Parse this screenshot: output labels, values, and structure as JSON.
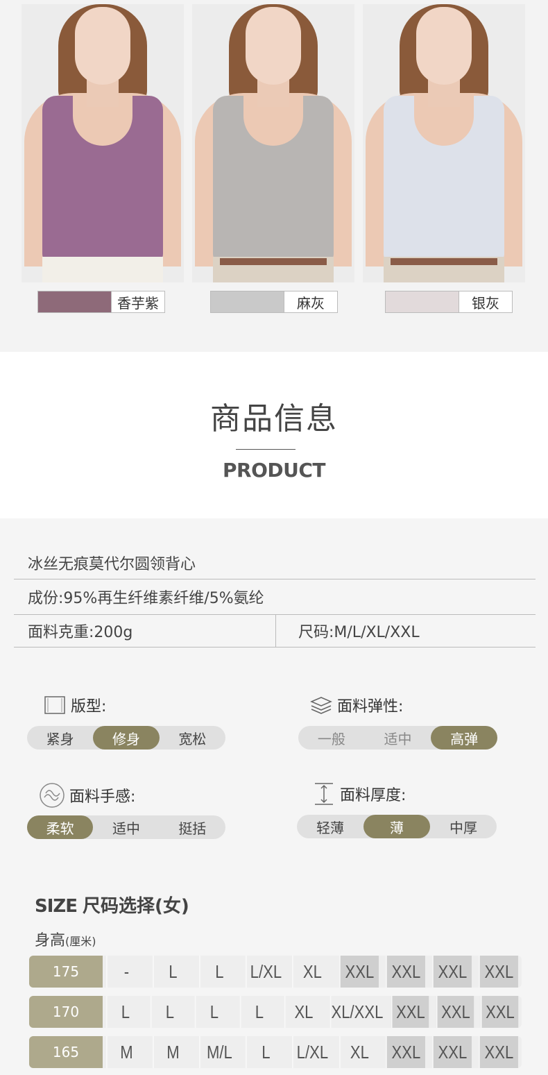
{
  "colors": [
    {
      "name": "香芋紫",
      "hex": "#8e6a79",
      "top_hex": "#9a6b92"
    },
    {
      "name": "麻灰",
      "hex": "#c9c9c9",
      "top_hex": "#b8b5b3"
    },
    {
      "name": "银灰",
      "hex": "#e2dadb",
      "top_hex": "#dde1ea"
    }
  ],
  "section": {
    "title": "商品信息",
    "subtitle": "PRODUCT"
  },
  "info": {
    "product_name": "冰丝无痕莫代尔圆领背心",
    "composition": "成份:95%再生纤维素纤维/5%氨纶",
    "weight": "面料克重:200g",
    "sizes": "尺码:M/L/XL/XXL"
  },
  "attributes": {
    "fit": {
      "label": "版型:",
      "options": [
        "紧身",
        "修身",
        "宽松"
      ],
      "selected": 1,
      "icon": "shirt-icon"
    },
    "elasticity": {
      "label": "面料弹性:",
      "options": [
        "一般",
        "适中",
        "高弹"
      ],
      "selected": 2,
      "icon": "layers-icon"
    },
    "feel": {
      "label": "面料手感:",
      "options": [
        "柔软",
        "适中",
        "挺括"
      ],
      "selected": 0,
      "icon": "texture-icon"
    },
    "thickness": {
      "label": "面料厚度:",
      "options": [
        "轻薄",
        "薄",
        "中厚"
      ],
      "selected": 1,
      "icon": "thickness-icon"
    }
  },
  "size_chart": {
    "title_en": "SIZE",
    "title_cn": "尺码选择(女)",
    "height_label": "身高",
    "height_unit": "(厘米)",
    "rows": [
      {
        "height": "175",
        "cells": [
          "-",
          "L",
          "L",
          "L/XL",
          "XL",
          "XXL",
          "XXL",
          "XXL",
          "XXL"
        ]
      },
      {
        "height": "170",
        "cells": [
          "L",
          "L",
          "L",
          "L",
          "XL",
          "XL/XXL",
          "XXL",
          "XXL",
          "XXL"
        ]
      },
      {
        "height": "165",
        "cells": [
          "M",
          "M",
          "M/L",
          "L",
          "L/XL",
          "XL",
          "XXL",
          "XXL",
          "XXL"
        ]
      }
    ],
    "dark_from": [
      5,
      6,
      6
    ]
  }
}
